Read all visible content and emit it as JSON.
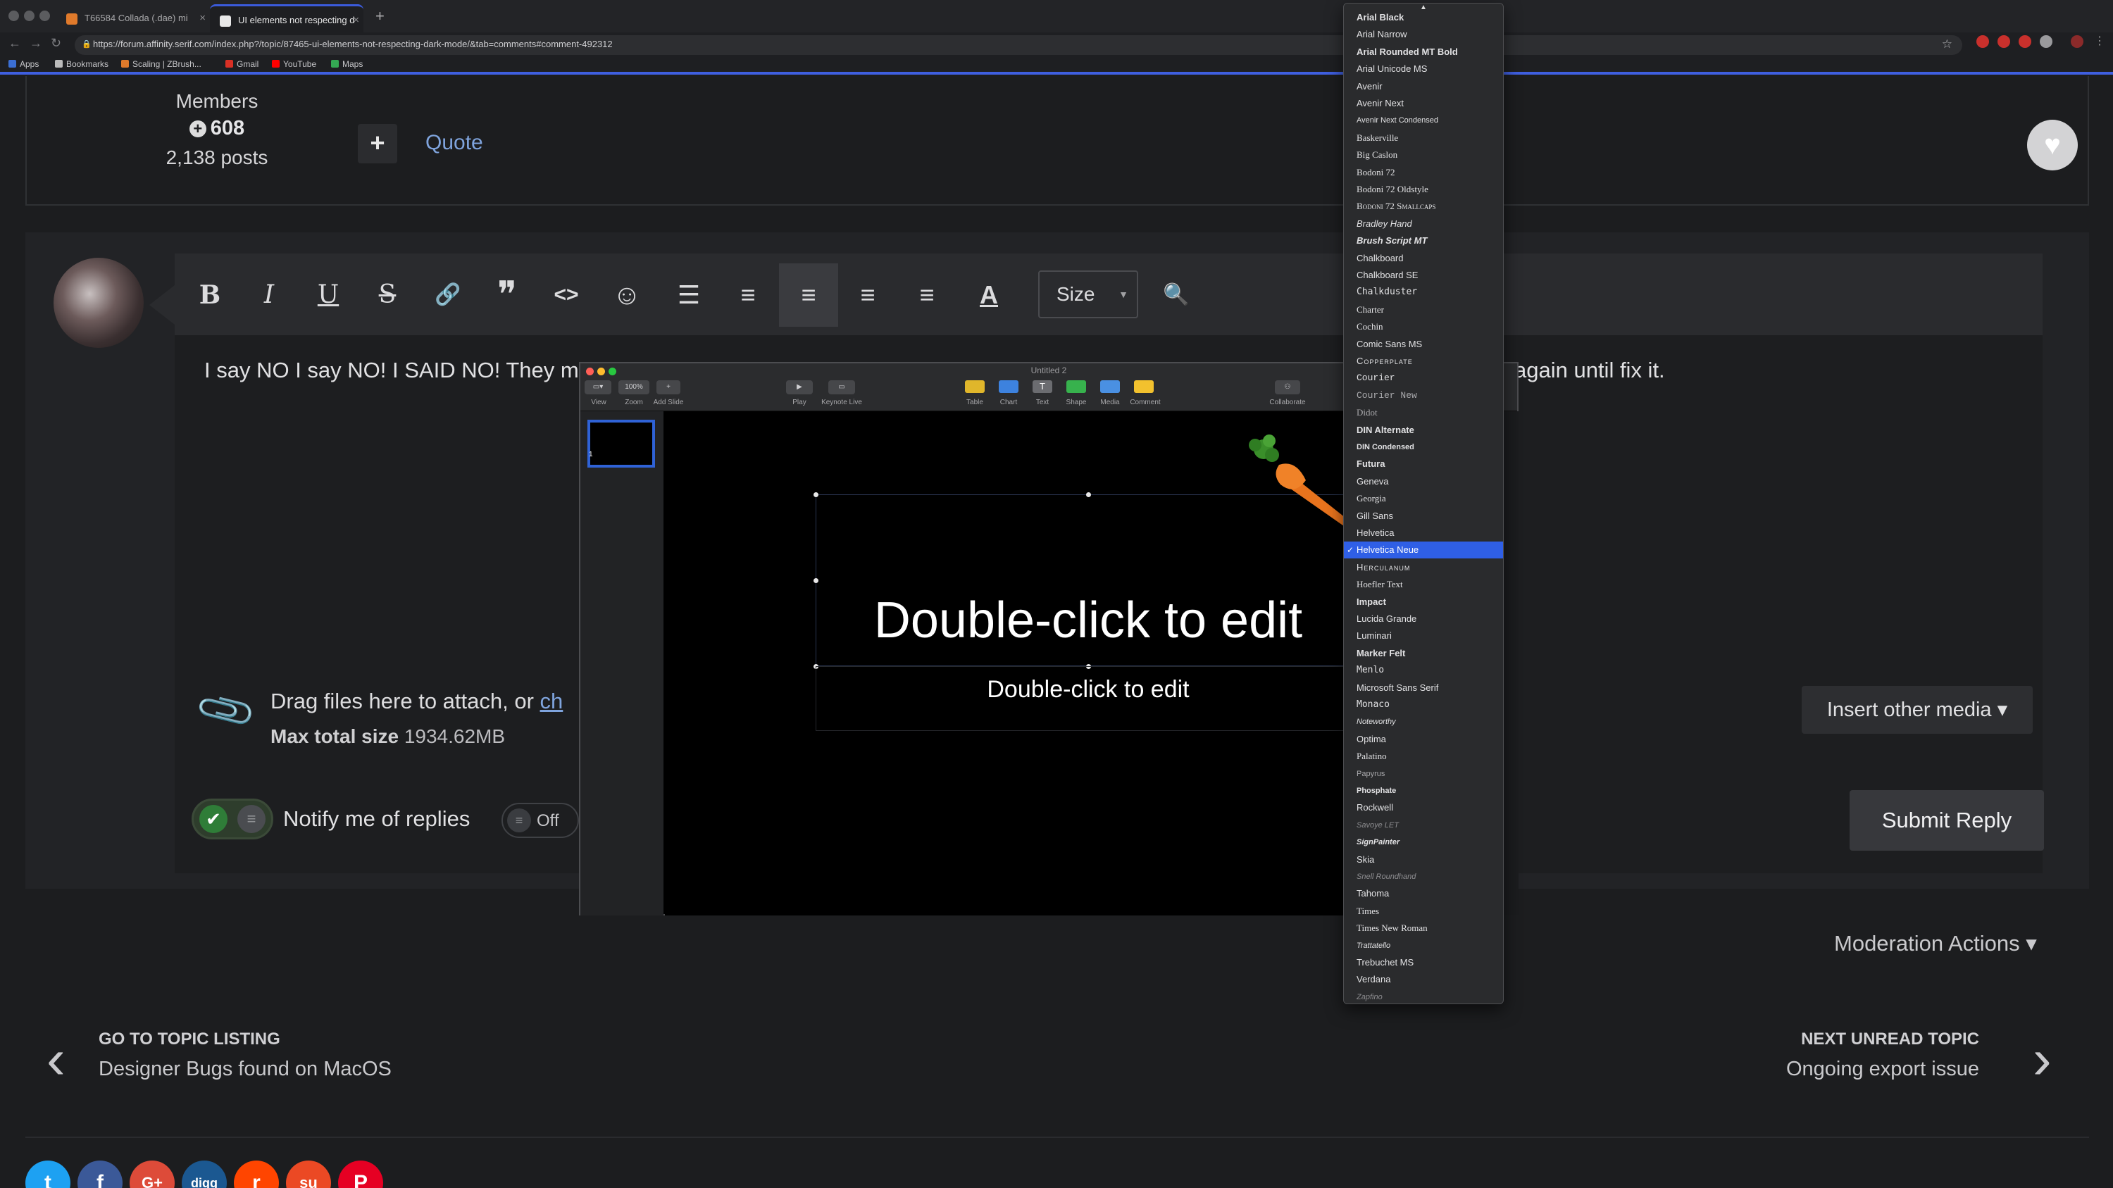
{
  "browser": {
    "tabs": [
      {
        "title": "T66584 Collada (.dae) mi"
      },
      {
        "title": "UI elements not respecting d"
      }
    ],
    "new_tab": "+",
    "url": "https://forum.affinity.serif.com/index.php?/topic/87465-ui-elements-not-respecting-dark-mode/&tab=comments#comment-492312",
    "bookmarks": [
      "Apps",
      "Bookmarks",
      "Scaling | ZBrush...",
      "Gmail",
      "YouTube",
      "Maps"
    ]
  },
  "post": {
    "member_group": "Members",
    "reputation": "608",
    "posts": "2,138 posts",
    "multiquote": "+",
    "quote": "Quote"
  },
  "editor": {
    "toolbar": {
      "bold": "B",
      "italic": "I",
      "underline": "U",
      "strike": "S",
      "link": "🔗",
      "blockquote": "❞",
      "code": "<>",
      "emoji": "☺",
      "bullets": "☰",
      "numbered": "≡",
      "align_left": "≡",
      "align_center": "≡",
      "align_right": "≡",
      "text_color": "A",
      "size_label": "Size",
      "preview": "🔍"
    },
    "text_left": "I say NO I say NO! I SAID NO! They m",
    "text_right": "again until fix it.",
    "attach_prefix": "Drag files here to attach, or ",
    "attach_link": "ch",
    "max_size_label": "Max total size",
    "max_size_value": "1934.62MB",
    "insert_media": "Insert other media ▾",
    "notify_label": "Notify me of replies",
    "off_label": "Off",
    "submit": "Submit Reply"
  },
  "moderation": "Moderation Actions ▾",
  "navigation": {
    "prev_title": "GO TO TOPIC LISTING",
    "prev_sub": "Designer Bugs found on MacOS",
    "next_title": "NEXT UNREAD TOPIC",
    "next_sub": "Ongoing export issue"
  },
  "social": [
    {
      "name": "twitter",
      "glyph": "t",
      "color": "#1da1f2"
    },
    {
      "name": "facebook",
      "glyph": "f",
      "color": "#3b5998"
    },
    {
      "name": "google-plus",
      "glyph": "G+",
      "color": "#dd4b39"
    },
    {
      "name": "digg",
      "glyph": "digg",
      "color": "#1b5891"
    },
    {
      "name": "reddit",
      "glyph": "r",
      "color": "#ff4500"
    },
    {
      "name": "stumbleupon",
      "glyph": "su",
      "color": "#eb4924"
    },
    {
      "name": "pinterest",
      "glyph": "P",
      "color": "#e60023"
    }
  ],
  "keynote": {
    "window_title": "Untitled 2",
    "toolbar": [
      {
        "label": "View"
      },
      {
        "label": "Zoom",
        "value": "100%"
      },
      {
        "label": "Add Slide"
      },
      {
        "label": "Play"
      },
      {
        "label": "Keynote Live"
      },
      {
        "label": "Table"
      },
      {
        "label": "Chart"
      },
      {
        "label": "Text"
      },
      {
        "label": "Shape"
      },
      {
        "label": "Media"
      },
      {
        "label": "Comment"
      },
      {
        "label": "Collaborate"
      }
    ],
    "slide_number": "1",
    "slide_title": "Double-click to edit",
    "slide_subtitle": "Double-click to edit"
  },
  "font_menu": {
    "selected": "Helvetica Neue",
    "items": [
      "Arial Black",
      "Arial Narrow",
      "Arial Rounded MT Bold",
      "Arial Unicode MS",
      "Avenir",
      "Avenir Next",
      "Avenir Next Condensed",
      "Baskerville",
      "Big Caslon",
      "Bodoni 72",
      "Bodoni 72 Oldstyle",
      "Bodoni 72 Smallcaps",
      "Bradley Hand",
      "Brush Script MT",
      "Chalkboard",
      "Chalkboard SE",
      "Chalkduster",
      "Charter",
      "Cochin",
      "Comic Sans MS",
      "Copperplate",
      "Courier",
      "Courier New",
      "Didot",
      "DIN Alternate",
      "DIN Condensed",
      "Futura",
      "Geneva",
      "Georgia",
      "Gill Sans",
      "Helvetica",
      "Helvetica Neue",
      "Herculanum",
      "Hoefler Text",
      "Impact",
      "Lucida Grande",
      "Luminari",
      "Marker Felt",
      "Menlo",
      "Microsoft Sans Serif",
      "Monaco",
      "Noteworthy",
      "Optima",
      "Palatino",
      "Papyrus",
      "Phosphate",
      "Rockwell",
      "Savoye LET",
      "SignPainter",
      "Skia",
      "Snell Roundhand",
      "Tahoma",
      "Times",
      "Times New Roman",
      "Trattatello",
      "Trebuchet MS",
      "Verdana",
      "Zapfino"
    ]
  },
  "colors": {
    "accent_blue": "#2f5fe6",
    "link_blue": "#7fa4dd",
    "toggle_green": "#2f7d38"
  }
}
